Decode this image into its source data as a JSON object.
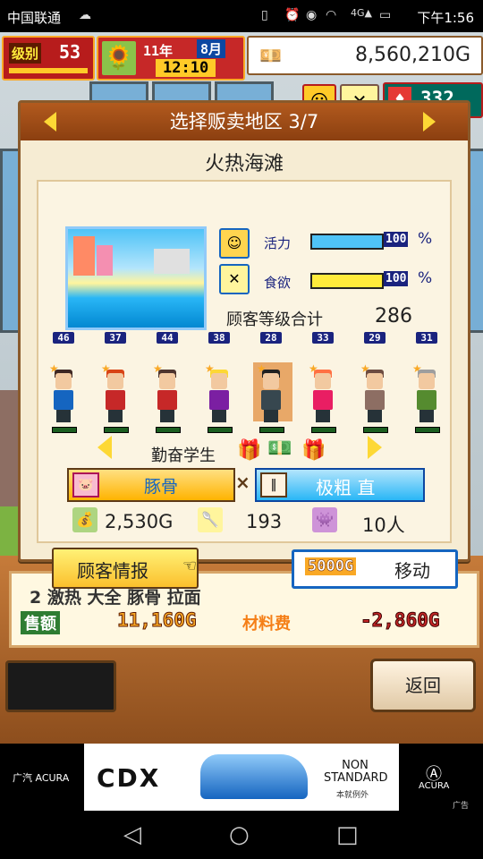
{
  "statusbar": {
    "carrier": "中国联通",
    "time": "下午1:56"
  },
  "hud": {
    "rank_label": "级别",
    "rank_value": "53",
    "date_year": "11年",
    "date_month": "8月",
    "clock": "12:10",
    "money": "8,560,210G",
    "counter": "332"
  },
  "dialog": {
    "title": "选择贩卖地区 3/7",
    "area_name": "火热海滩",
    "stats": [
      {
        "label": "活力",
        "value": "100",
        "fill": 1.0,
        "color": "#4fc3f7"
      },
      {
        "label": "食欲",
        "value": "100",
        "fill": 1.0,
        "color": "#ffeb3b"
      }
    ],
    "customer_level_label": "顾客等级合计",
    "customer_level_value": "286",
    "customers": [
      {
        "level": "46"
      },
      {
        "level": "37"
      },
      {
        "level": "44"
      },
      {
        "level": "38"
      },
      {
        "level": "28"
      },
      {
        "level": "33"
      },
      {
        "level": "29"
      },
      {
        "level": "31"
      }
    ],
    "selected_customer_type": "勤奋学生",
    "soup_label": "豚骨",
    "noodle_label": "极粗 直",
    "price": "2,530G",
    "score": "193",
    "people": "10人"
  },
  "buttons": {
    "customer_info": "顾客情报",
    "move": "移动",
    "move_cost": "5000G",
    "back": "返回"
  },
  "below": {
    "menu_row": "2 激热 大全 豚骨 拉面",
    "sales_label": "售额",
    "sales_value": "11,160G",
    "cost_label": "材料费",
    "cost_value": "-2,860G"
  },
  "ad": {
    "brand_left": "广汽 ACURA",
    "model": "CDX",
    "tagline": "NON STANDARD",
    "tagline_cn": "本就例外",
    "brand_right": "ACURA",
    "ad_label": "广告"
  }
}
